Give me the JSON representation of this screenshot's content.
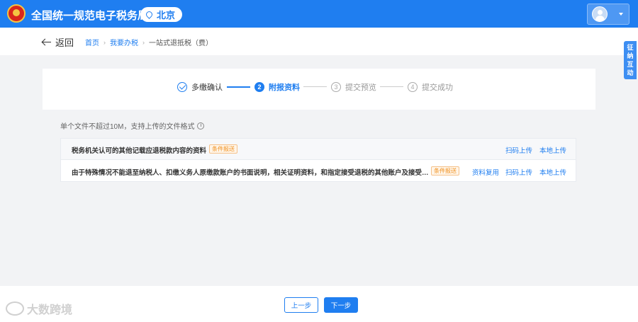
{
  "header": {
    "title": "全国统一规范电子税务局",
    "city": "北京"
  },
  "subheader": {
    "back_label": "返回",
    "breadcrumb": [
      "首页",
      "我要办税",
      "一站式退抵税（费）"
    ]
  },
  "side_tab": [
    "征",
    "纳",
    "互",
    "动"
  ],
  "steps": [
    {
      "num": "1",
      "label": "多缴确认",
      "state": "done"
    },
    {
      "num": "2",
      "label": "附报资料",
      "state": "active"
    },
    {
      "num": "3",
      "label": "提交预览",
      "state": "todo"
    },
    {
      "num": "4",
      "label": "提交成功",
      "state": "todo"
    }
  ],
  "note": "单个文件不超过10M，支持上传的文件格式",
  "upload_rows": [
    {
      "title": "税务机关认可的其他记载应退税款内容的资料",
      "tag": "条件报送",
      "actions": [
        "扫码上传",
        "本地上传"
      ]
    },
    {
      "title": "由于特殊情况不能退至纳税人、扣缴义务人原缴款账户的书面说明，相关证明资料，和指定接受退税的其他账户及接受退税单位（人）名称",
      "tag": "条件报送",
      "actions": [
        "资料复用",
        "扫码上传",
        "本地上传"
      ]
    }
  ],
  "footer": {
    "prev_label": "上一步",
    "next_label": "下一步"
  },
  "watermark": "大数跨境",
  "colors": {
    "primary": "#1f7ef0",
    "tag": "#f0901f"
  }
}
